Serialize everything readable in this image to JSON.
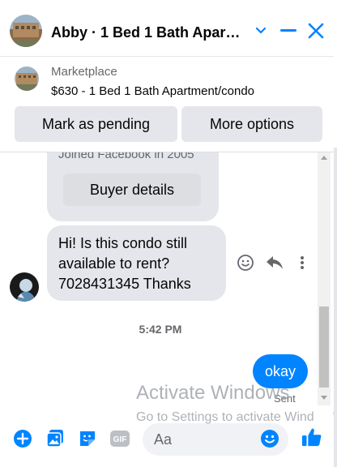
{
  "header": {
    "title": "Abby · 1 Bed 1 Bath Apart…"
  },
  "marketplace": {
    "label": "Marketplace",
    "listing": "$630 - 1 Bed 1 Bath Apartment/condo",
    "pending_button": "Mark as pending",
    "more_button": "More options"
  },
  "conversation": {
    "card_text": "Joined Facebook in 2005",
    "buyer_details_button": "Buyer details",
    "incoming_message": "Hi! Is this condo still\navailable to rent?\n7028431345 Thanks",
    "timestamp": "5:42 PM",
    "outgoing_message": "okay",
    "status": "Sent"
  },
  "watermark": {
    "line1": "Activate Windows",
    "line2": "Go to Settings to activate Wind"
  },
  "composer": {
    "placeholder": "Aa"
  },
  "colors": {
    "accent": "#0084ff",
    "bubble": "#e4e6eb"
  }
}
